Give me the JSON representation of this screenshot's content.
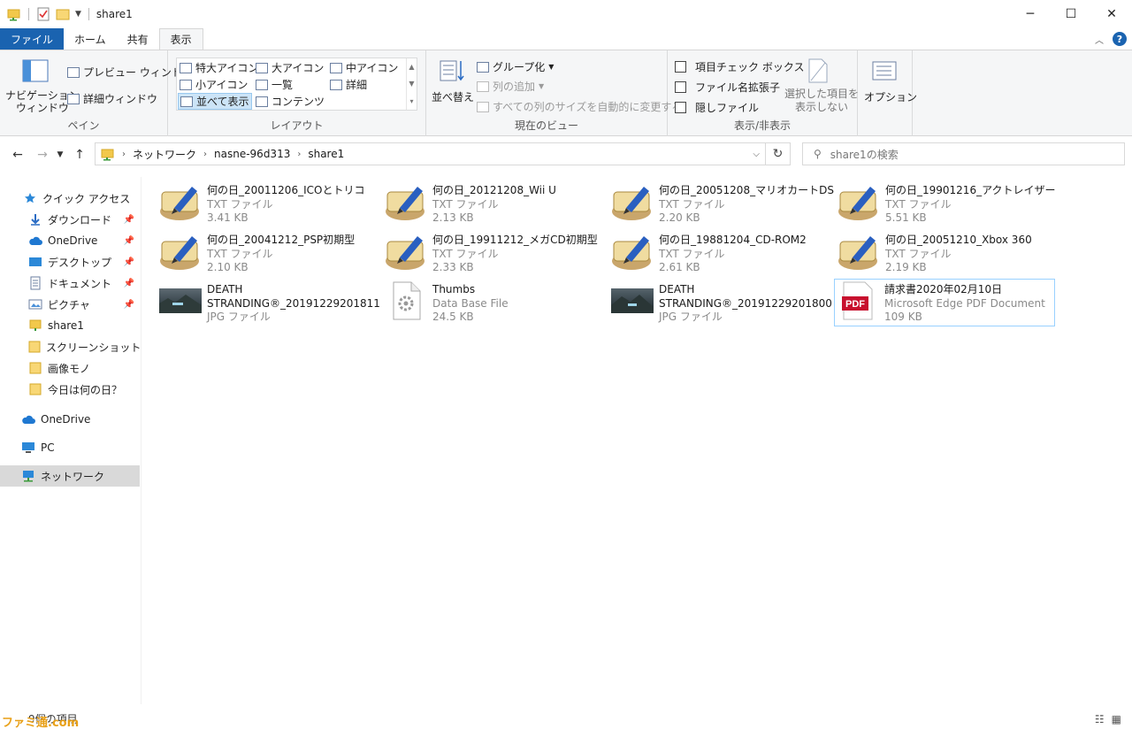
{
  "window": {
    "title": "share1",
    "buttons": {
      "minimize": "─",
      "maximize": "☐",
      "close": "✕"
    }
  },
  "ribbon_tabs": [
    {
      "label": "ファイル",
      "type": "file"
    },
    {
      "label": "ホーム",
      "type": "normal"
    },
    {
      "label": "共有",
      "type": "normal"
    },
    {
      "label": "表示",
      "type": "active"
    }
  ],
  "ribbon": {
    "pane_group": {
      "label": "ペイン",
      "nav_pane": "ナビゲーション\nウィンドウ",
      "preview": "プレビュー ウィンドウ",
      "details": "詳細ウィンドウ"
    },
    "layout_group": {
      "label": "レイアウト",
      "items": [
        "特大アイコン",
        "大アイコン",
        "中アイコン",
        "小アイコン",
        "一覧",
        "詳細",
        "並べて表示",
        "コンテンツ"
      ]
    },
    "current_view_group": {
      "label": "現在のビュー",
      "sort": "並べ替え",
      "group_by": "グループ化",
      "add_column": "列の追加",
      "autosize": "すべての列のサイズを自動的に変更する"
    },
    "show_hide_group": {
      "label": "表示/非表示",
      "item_checkbox": "項目チェック ボックス",
      "file_ext": "ファイル名拡張子",
      "hidden": "隠しファイル",
      "hide_selected": "選択した項目を\n表示しない"
    },
    "options": {
      "label": "オプション"
    }
  },
  "address": {
    "crumbs": [
      "ネットワーク",
      "nasne-96d313",
      "share1"
    ],
    "search_placeholder": "share1の検索"
  },
  "nav_pane": [
    {
      "label": "クイック アクセス",
      "icon": "star-icon",
      "pinned": false,
      "indent": 1
    },
    {
      "label": "ダウンロード",
      "icon": "download-icon",
      "pinned": true,
      "indent": 2
    },
    {
      "label": "OneDrive",
      "icon": "cloud-icon",
      "pinned": true,
      "indent": 2
    },
    {
      "label": "デスクトップ",
      "icon": "desktop-icon",
      "pinned": true,
      "indent": 2
    },
    {
      "label": "ドキュメント",
      "icon": "document-icon",
      "pinned": true,
      "indent": 2
    },
    {
      "label": "ピクチャ",
      "icon": "pictures-icon",
      "pinned": true,
      "indent": 2
    },
    {
      "label": "share1",
      "icon": "network-folder-icon",
      "pinned": false,
      "indent": 2
    },
    {
      "label": "スクリーンショット",
      "icon": "folder-icon",
      "pinned": false,
      "indent": 2
    },
    {
      "label": "画像モノ",
      "icon": "folder-icon",
      "pinned": false,
      "indent": 2
    },
    {
      "label": "今日は何の日？",
      "icon": "folder-icon",
      "pinned": false,
      "indent": 2
    },
    {
      "label": "OneDrive",
      "icon": "cloud-icon",
      "pinned": false,
      "indent": 1
    },
    {
      "label": "PC",
      "icon": "pc-icon",
      "pinned": false,
      "indent": 1
    },
    {
      "label": "ネットワーク",
      "icon": "network-icon",
      "pinned": false,
      "indent": 1
    }
  ],
  "files": [
    {
      "name": "何の日_20011206_ICOとトリコ",
      "type": "TXT ファイル",
      "size": "3.41 KB",
      "icon": "txt-icon"
    },
    {
      "name": "何の日_20121208_Wii U",
      "type": "TXT ファイル",
      "size": "2.13 KB",
      "icon": "txt-icon"
    },
    {
      "name": "何の日_20051208_マリオカートDS",
      "type": "TXT ファイル",
      "size": "2.20 KB",
      "icon": "txt-icon"
    },
    {
      "name": "何の日_19901216_アクトレイザー",
      "type": "TXT ファイル",
      "size": "5.51 KB",
      "icon": "txt-icon"
    },
    {
      "name": "何の日_20041212_PSP初期型",
      "type": "TXT ファイル",
      "size": "2.10 KB",
      "icon": "txt-icon"
    },
    {
      "name": "何の日_19911212_メガCD初期型",
      "type": "TXT ファイル",
      "size": "2.33 KB",
      "icon": "txt-icon"
    },
    {
      "name": "何の日_19881204_CD-ROM2",
      "type": "TXT ファイル",
      "size": "2.61 KB",
      "icon": "txt-icon"
    },
    {
      "name": "何の日_20051210_Xbox 360",
      "type": "TXT ファイル",
      "size": "2.19 KB",
      "icon": "txt-icon"
    },
    {
      "name": "DEATH",
      "name2": "STRANDING®_20191229201811",
      "type": "JPG ファイル",
      "icon": "image-thumbnail-icon"
    },
    {
      "name": "Thumbs",
      "type": "Data Base File",
      "size": "24.5 KB",
      "icon": "db-file-icon"
    },
    {
      "name": "DEATH",
      "name2": "STRANDING®_20191229201800",
      "type": "JPG ファイル",
      "icon": "image-thumbnail-icon"
    },
    {
      "name": "請求書2020年02月10日",
      "type": "Microsoft Edge PDF Document",
      "size": "109 KB",
      "icon": "pdf-icon",
      "pdf_label": "PDF"
    }
  ],
  "status": {
    "text": "9個の項目"
  },
  "watermark": "ファミ通.com",
  "colors": {
    "accent": "#1a63b0",
    "selection": "#cce4f7",
    "pdf_red": "#c8102e"
  }
}
